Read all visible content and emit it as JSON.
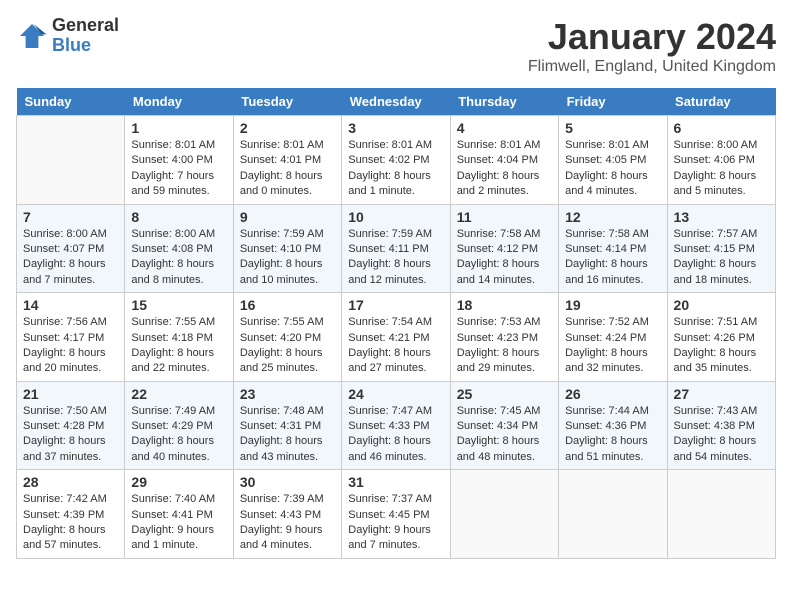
{
  "header": {
    "logo_general": "General",
    "logo_blue": "Blue",
    "month_title": "January 2024",
    "location": "Flimwell, England, United Kingdom"
  },
  "weekdays": [
    "Sunday",
    "Monday",
    "Tuesday",
    "Wednesday",
    "Thursday",
    "Friday",
    "Saturday"
  ],
  "weeks": [
    [
      {
        "day": "",
        "sunrise": "",
        "sunset": "",
        "daylight": ""
      },
      {
        "day": "1",
        "sunrise": "Sunrise: 8:01 AM",
        "sunset": "Sunset: 4:00 PM",
        "daylight": "Daylight: 7 hours and 59 minutes."
      },
      {
        "day": "2",
        "sunrise": "Sunrise: 8:01 AM",
        "sunset": "Sunset: 4:01 PM",
        "daylight": "Daylight: 8 hours and 0 minutes."
      },
      {
        "day": "3",
        "sunrise": "Sunrise: 8:01 AM",
        "sunset": "Sunset: 4:02 PM",
        "daylight": "Daylight: 8 hours and 1 minute."
      },
      {
        "day": "4",
        "sunrise": "Sunrise: 8:01 AM",
        "sunset": "Sunset: 4:04 PM",
        "daylight": "Daylight: 8 hours and 2 minutes."
      },
      {
        "day": "5",
        "sunrise": "Sunrise: 8:01 AM",
        "sunset": "Sunset: 4:05 PM",
        "daylight": "Daylight: 8 hours and 4 minutes."
      },
      {
        "day": "6",
        "sunrise": "Sunrise: 8:00 AM",
        "sunset": "Sunset: 4:06 PM",
        "daylight": "Daylight: 8 hours and 5 minutes."
      }
    ],
    [
      {
        "day": "7",
        "sunrise": "Sunrise: 8:00 AM",
        "sunset": "Sunset: 4:07 PM",
        "daylight": "Daylight: 8 hours and 7 minutes."
      },
      {
        "day": "8",
        "sunrise": "Sunrise: 8:00 AM",
        "sunset": "Sunset: 4:08 PM",
        "daylight": "Daylight: 8 hours and 8 minutes."
      },
      {
        "day": "9",
        "sunrise": "Sunrise: 7:59 AM",
        "sunset": "Sunset: 4:10 PM",
        "daylight": "Daylight: 8 hours and 10 minutes."
      },
      {
        "day": "10",
        "sunrise": "Sunrise: 7:59 AM",
        "sunset": "Sunset: 4:11 PM",
        "daylight": "Daylight: 8 hours and 12 minutes."
      },
      {
        "day": "11",
        "sunrise": "Sunrise: 7:58 AM",
        "sunset": "Sunset: 4:12 PM",
        "daylight": "Daylight: 8 hours and 14 minutes."
      },
      {
        "day": "12",
        "sunrise": "Sunrise: 7:58 AM",
        "sunset": "Sunset: 4:14 PM",
        "daylight": "Daylight: 8 hours and 16 minutes."
      },
      {
        "day": "13",
        "sunrise": "Sunrise: 7:57 AM",
        "sunset": "Sunset: 4:15 PM",
        "daylight": "Daylight: 8 hours and 18 minutes."
      }
    ],
    [
      {
        "day": "14",
        "sunrise": "Sunrise: 7:56 AM",
        "sunset": "Sunset: 4:17 PM",
        "daylight": "Daylight: 8 hours and 20 minutes."
      },
      {
        "day": "15",
        "sunrise": "Sunrise: 7:55 AM",
        "sunset": "Sunset: 4:18 PM",
        "daylight": "Daylight: 8 hours and 22 minutes."
      },
      {
        "day": "16",
        "sunrise": "Sunrise: 7:55 AM",
        "sunset": "Sunset: 4:20 PM",
        "daylight": "Daylight: 8 hours and 25 minutes."
      },
      {
        "day": "17",
        "sunrise": "Sunrise: 7:54 AM",
        "sunset": "Sunset: 4:21 PM",
        "daylight": "Daylight: 8 hours and 27 minutes."
      },
      {
        "day": "18",
        "sunrise": "Sunrise: 7:53 AM",
        "sunset": "Sunset: 4:23 PM",
        "daylight": "Daylight: 8 hours and 29 minutes."
      },
      {
        "day": "19",
        "sunrise": "Sunrise: 7:52 AM",
        "sunset": "Sunset: 4:24 PM",
        "daylight": "Daylight: 8 hours and 32 minutes."
      },
      {
        "day": "20",
        "sunrise": "Sunrise: 7:51 AM",
        "sunset": "Sunset: 4:26 PM",
        "daylight": "Daylight: 8 hours and 35 minutes."
      }
    ],
    [
      {
        "day": "21",
        "sunrise": "Sunrise: 7:50 AM",
        "sunset": "Sunset: 4:28 PM",
        "daylight": "Daylight: 8 hours and 37 minutes."
      },
      {
        "day": "22",
        "sunrise": "Sunrise: 7:49 AM",
        "sunset": "Sunset: 4:29 PM",
        "daylight": "Daylight: 8 hours and 40 minutes."
      },
      {
        "day": "23",
        "sunrise": "Sunrise: 7:48 AM",
        "sunset": "Sunset: 4:31 PM",
        "daylight": "Daylight: 8 hours and 43 minutes."
      },
      {
        "day": "24",
        "sunrise": "Sunrise: 7:47 AM",
        "sunset": "Sunset: 4:33 PM",
        "daylight": "Daylight: 8 hours and 46 minutes."
      },
      {
        "day": "25",
        "sunrise": "Sunrise: 7:45 AM",
        "sunset": "Sunset: 4:34 PM",
        "daylight": "Daylight: 8 hours and 48 minutes."
      },
      {
        "day": "26",
        "sunrise": "Sunrise: 7:44 AM",
        "sunset": "Sunset: 4:36 PM",
        "daylight": "Daylight: 8 hours and 51 minutes."
      },
      {
        "day": "27",
        "sunrise": "Sunrise: 7:43 AM",
        "sunset": "Sunset: 4:38 PM",
        "daylight": "Daylight: 8 hours and 54 minutes."
      }
    ],
    [
      {
        "day": "28",
        "sunrise": "Sunrise: 7:42 AM",
        "sunset": "Sunset: 4:39 PM",
        "daylight": "Daylight: 8 hours and 57 minutes."
      },
      {
        "day": "29",
        "sunrise": "Sunrise: 7:40 AM",
        "sunset": "Sunset: 4:41 PM",
        "daylight": "Daylight: 9 hours and 1 minute."
      },
      {
        "day": "30",
        "sunrise": "Sunrise: 7:39 AM",
        "sunset": "Sunset: 4:43 PM",
        "daylight": "Daylight: 9 hours and 4 minutes."
      },
      {
        "day": "31",
        "sunrise": "Sunrise: 7:37 AM",
        "sunset": "Sunset: 4:45 PM",
        "daylight": "Daylight: 9 hours and 7 minutes."
      },
      {
        "day": "",
        "sunrise": "",
        "sunset": "",
        "daylight": ""
      },
      {
        "day": "",
        "sunrise": "",
        "sunset": "",
        "daylight": ""
      },
      {
        "day": "",
        "sunrise": "",
        "sunset": "",
        "daylight": ""
      }
    ]
  ]
}
